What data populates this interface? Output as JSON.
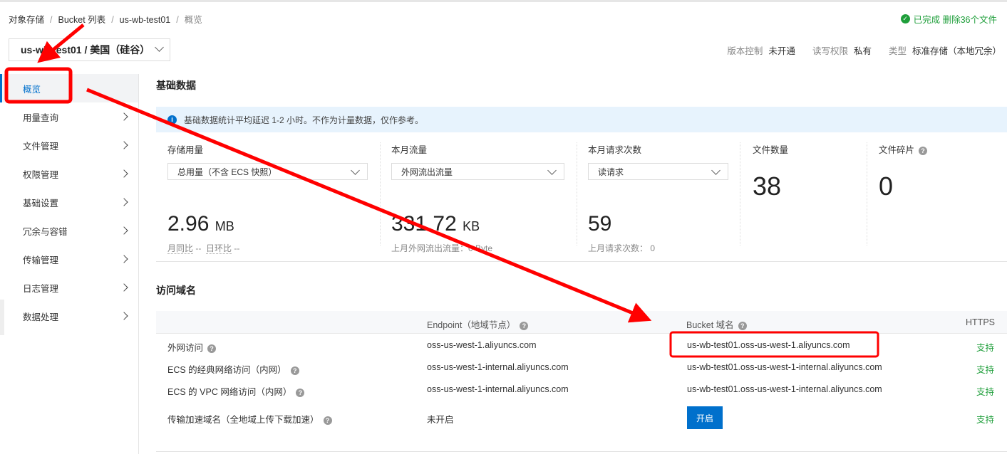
{
  "breadcrumb": [
    "对象存储",
    "Bucket 列表",
    "us-wb-test01",
    "概览"
  ],
  "status": {
    "text": "已完成 删除36个文件"
  },
  "bucket_select": "us-wb-test01 / 美国（硅谷）",
  "meta": {
    "versioning_label": "版本控制",
    "versioning": "未开通",
    "acl_label": "读写权限",
    "acl": "私有",
    "type_label": "类型",
    "type": "标准存储（本地冗余）"
  },
  "sidebar": {
    "items": [
      {
        "label": "概览"
      },
      {
        "label": "用量查询"
      },
      {
        "label": "文件管理"
      },
      {
        "label": "权限管理"
      },
      {
        "label": "基础设置"
      },
      {
        "label": "冗余与容错"
      },
      {
        "label": "传输管理"
      },
      {
        "label": "日志管理"
      },
      {
        "label": "数据处理"
      }
    ]
  },
  "basic": {
    "title": "基础数据",
    "info": "基础数据统计平均延迟 1-2 小时。不作为计量数据，仅作参考。",
    "storage": {
      "label": "存储用量",
      "select": "总用量（不含 ECS 快照）",
      "value": "2.96",
      "unit": "MB",
      "yoy": "月同比",
      "yoy_val": "--",
      "mom": "日环比",
      "mom_val": "--"
    },
    "traffic": {
      "label": "本月流量",
      "select": "外网流出流量",
      "value": "331.72",
      "unit": "KB",
      "sub": "上月外网流出流量：0 Byte"
    },
    "requests": {
      "label": "本月请求次数",
      "select": "读请求",
      "value": "59",
      "sub": "上月请求次数：  0"
    },
    "files": {
      "label": "文件数量",
      "value": "38"
    },
    "fragments": {
      "label": "文件碎片",
      "value": "0"
    }
  },
  "domains": {
    "title": "访问域名",
    "headers": [
      "Endpoint（地域节点）",
      "Bucket 域名",
      "HTTPS"
    ],
    "rows": [
      {
        "name": "外网访问",
        "endpoint": "oss-us-west-1.aliyuncs.com",
        "bucket": "us-wb-test01.oss-us-west-1.aliyuncs.com",
        "https": "支持"
      },
      {
        "name": "ECS 的经典网络访问（内网）",
        "endpoint": "oss-us-west-1-internal.aliyuncs.com",
        "bucket": "us-wb-test01.oss-us-west-1-internal.aliyuncs.com",
        "https": "支持"
      },
      {
        "name": "ECS 的 VPC 网络访问（内网）",
        "endpoint": "oss-us-west-1-internal.aliyuncs.com",
        "bucket": "us-wb-test01.oss-us-west-1-internal.aliyuncs.com",
        "https": "支持"
      },
      {
        "name": "传输加速域名（全地域上传下载加速）",
        "endpoint": "未开启",
        "button": "开启",
        "https": "支持"
      }
    ]
  },
  "colors": {
    "accent": "#0070cc",
    "success": "#1e9e3a",
    "annotation": "#ff0000"
  }
}
